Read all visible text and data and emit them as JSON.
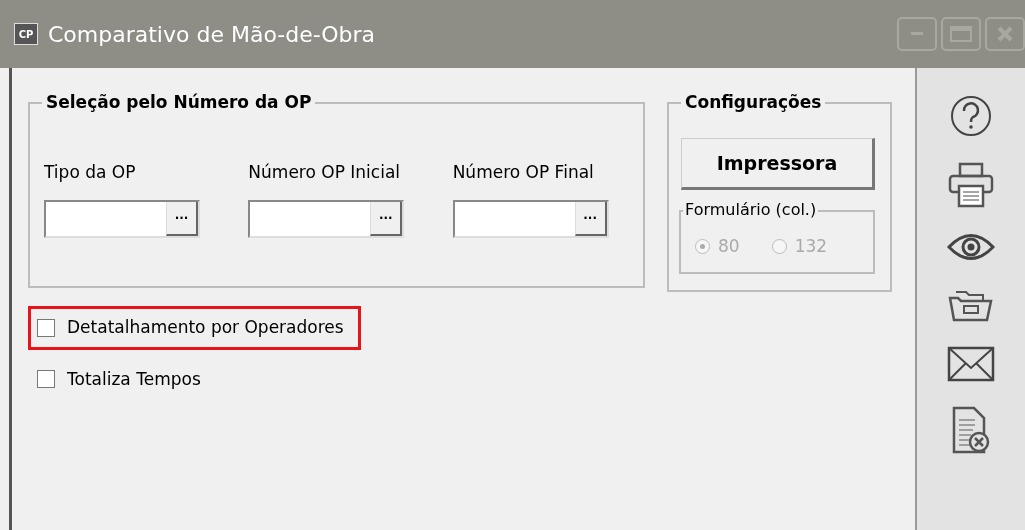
{
  "window": {
    "title": "Comparativo de Mão-de-Obra",
    "icon_text": "CP",
    "controls": [
      {
        "kind": "minimize"
      },
      {
        "kind": "maximize"
      },
      {
        "kind": "close"
      }
    ]
  },
  "selection_group": {
    "title": "Seleção pelo Número da OP",
    "fields": [
      {
        "label": "Tipo da OP",
        "button": "···"
      },
      {
        "label": "Número OP Inicial",
        "button": "···"
      },
      {
        "label": "Número OP Final",
        "button": "···"
      }
    ]
  },
  "config_group": {
    "title": "Configurações",
    "printer_button": "Impressora",
    "form_group": {
      "title": "Formulário (col.)",
      "options": [
        {
          "label": "80",
          "selected": true,
          "disabled": true
        },
        {
          "label": "132",
          "selected": false,
          "disabled": true
        }
      ]
    }
  },
  "checkboxes": [
    {
      "label": "Detatalhamento por Operadores",
      "checked": false,
      "highlighted": true
    },
    {
      "label": "Totaliza Tempos",
      "checked": false,
      "highlighted": false
    }
  ],
  "sidebar": [
    {
      "kind": "help"
    },
    {
      "kind": "print"
    },
    {
      "kind": "preview"
    },
    {
      "kind": "folder"
    },
    {
      "kind": "mail"
    },
    {
      "kind": "delete-doc"
    }
  ]
}
